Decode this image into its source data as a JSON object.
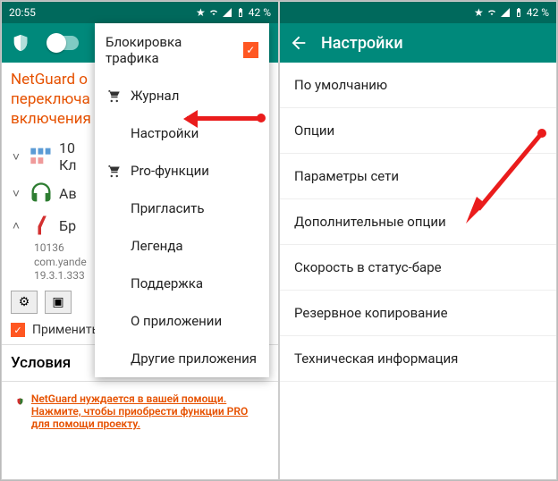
{
  "status": {
    "time": "20:55",
    "battery": "42 %"
  },
  "left": {
    "message": "NetGuard о\nпереключа\nвключения",
    "apps": [
      {
        "label": "10\nКл",
        "chev": "˅"
      },
      {
        "label": "Ав",
        "chev": "˅"
      },
      {
        "label": "Бр",
        "chev": "˄"
      }
    ],
    "meta": {
      "id": "10136",
      "pkg": "com.yande",
      "ver": "19.3.1.333"
    },
    "applyRules": "Применить правила и условия",
    "section": "Условия",
    "help": "NetGuard нуждается в вашей помощи. Нажмите, чтобы приобрести функции PRO для помощи проекту.",
    "menu": [
      {
        "label": "Блокировка трафика",
        "checked": true
      },
      {
        "label": "Журнал"
      },
      {
        "label": "Настройки"
      },
      {
        "label": "Pro-функции"
      },
      {
        "label": "Пригласить"
      },
      {
        "label": "Легенда"
      },
      {
        "label": "Поддержка"
      },
      {
        "label": "О приложении"
      },
      {
        "label": "Другие приложения"
      }
    ]
  },
  "right": {
    "title": "Настройки",
    "items": [
      "По умолчанию",
      "Опции",
      "Параметры сети",
      "Дополнительные опции",
      "Скорость в статус-баре",
      "Резервное копирование",
      "Техническая информация"
    ]
  }
}
